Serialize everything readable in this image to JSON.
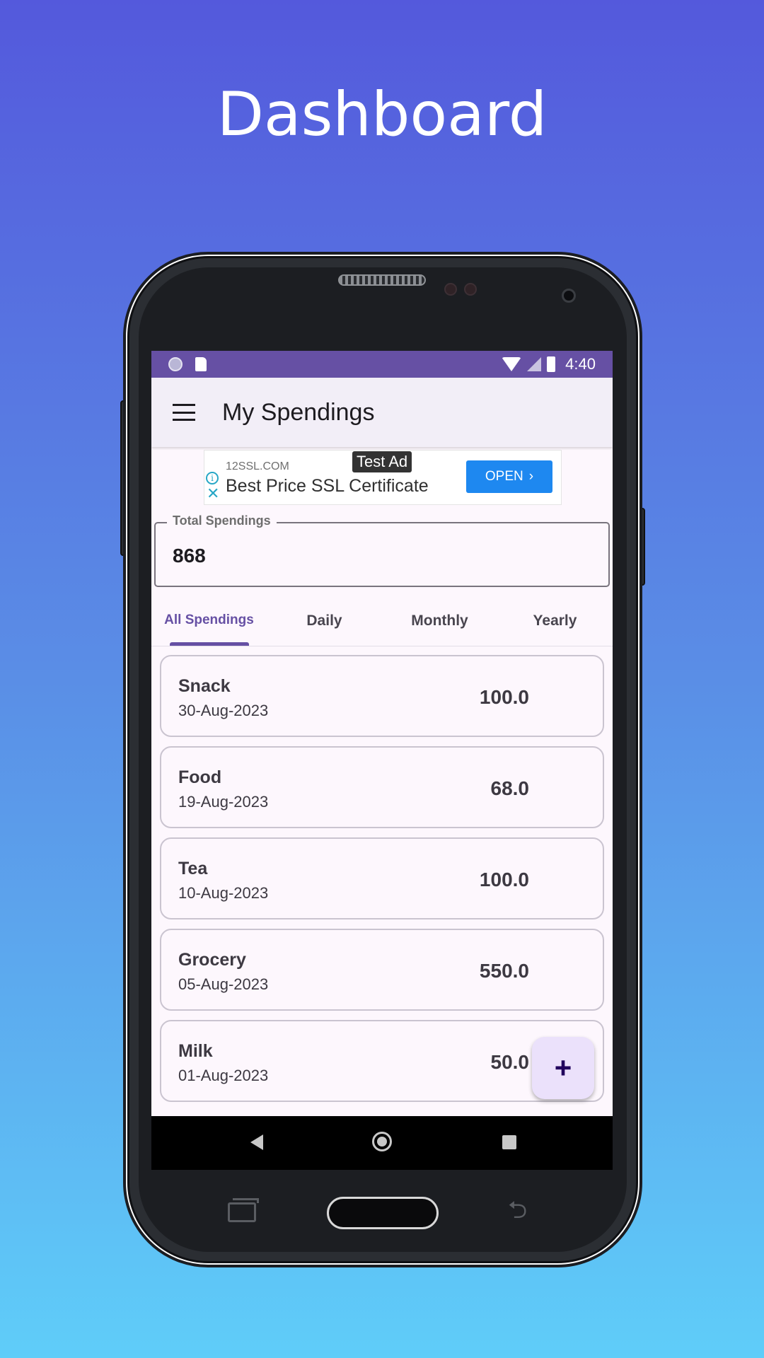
{
  "banner": {
    "title": "Dashboard"
  },
  "status_bar": {
    "time": "4:40"
  },
  "app_bar": {
    "title": "My Spendings"
  },
  "ad": {
    "badge": "Test Ad",
    "domain": "12SSL.COM",
    "headline": "Best Price SSL Certificate",
    "button_label": "OPEN",
    "info_glyph": "i",
    "close_glyph": "✕"
  },
  "total": {
    "label": "Total Spendings",
    "value": "868"
  },
  "tabs": [
    {
      "label": "All Spendings",
      "active": true
    },
    {
      "label": "Daily",
      "active": false
    },
    {
      "label": "Monthly",
      "active": false
    },
    {
      "label": "Yearly",
      "active": false
    }
  ],
  "spendings": [
    {
      "name": "Snack",
      "date": "30-Aug-2023",
      "amount": "100.0"
    },
    {
      "name": "Food",
      "date": "19-Aug-2023",
      "amount": "68.0"
    },
    {
      "name": "Tea",
      "date": "10-Aug-2023",
      "amount": "100.0"
    },
    {
      "name": "Grocery",
      "date": "05-Aug-2023",
      "amount": "550.0"
    },
    {
      "name": "Milk",
      "date": "01-Aug-2023",
      "amount": "50.0"
    }
  ],
  "fab": {
    "label": "+"
  },
  "colors": {
    "accent": "#6650a4",
    "status_bar": "#6650a4",
    "background_top": "#5459dc",
    "background_bottom": "#5fcdf9"
  },
  "icons": {
    "menu": "menu-icon",
    "add": "add-icon",
    "nav_back": "nav-back-icon",
    "nav_home": "nav-home-icon",
    "nav_recents": "nav-recents-icon"
  }
}
